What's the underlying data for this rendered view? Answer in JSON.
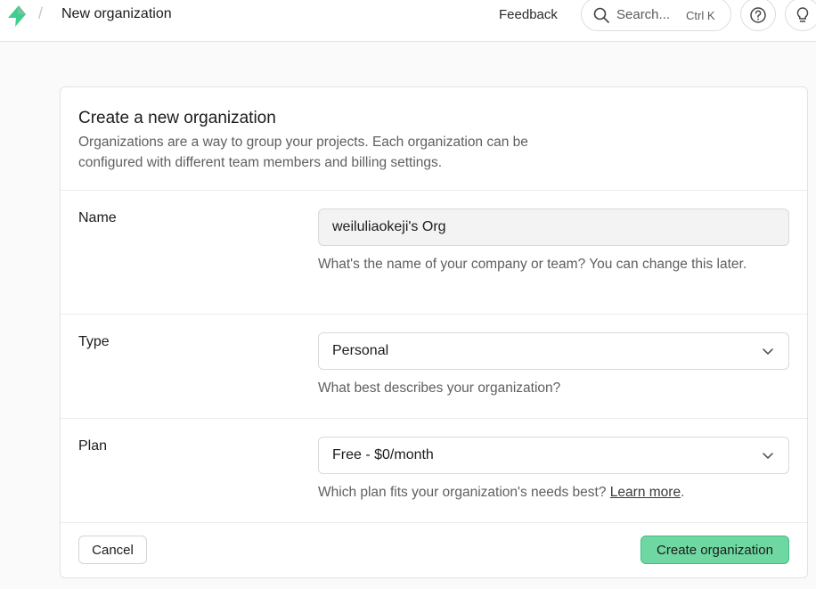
{
  "header": {
    "breadcrumb_separator": "/",
    "page_title": "New organization",
    "feedback_label": "Feedback",
    "search_label": "Search...",
    "search_shortcut": "Ctrl K",
    "icons": [
      "supabase-logo",
      "search-icon",
      "help-icon",
      "lightbulb-icon"
    ],
    "brand_color": "#3ecf8e"
  },
  "card": {
    "title": "Create a new organization",
    "description": "Organizations are a way to group your projects. Each organization can be configured with different team members and billing settings.",
    "name": {
      "label": "Name",
      "value": "weiluliaokeji's Org",
      "help": "What's the name of your company or team? You can change this later."
    },
    "type": {
      "label": "Type",
      "value": "Personal",
      "help": "What best describes your organization?"
    },
    "plan": {
      "label": "Plan",
      "value": "Free - $0/month",
      "help": "Which plan fits your organization's needs best?",
      "link": "Learn more",
      "help_suffix": "."
    },
    "cancel_label": "Cancel",
    "submit_label": "Create organization",
    "submit_color": "#6fd7a1"
  }
}
